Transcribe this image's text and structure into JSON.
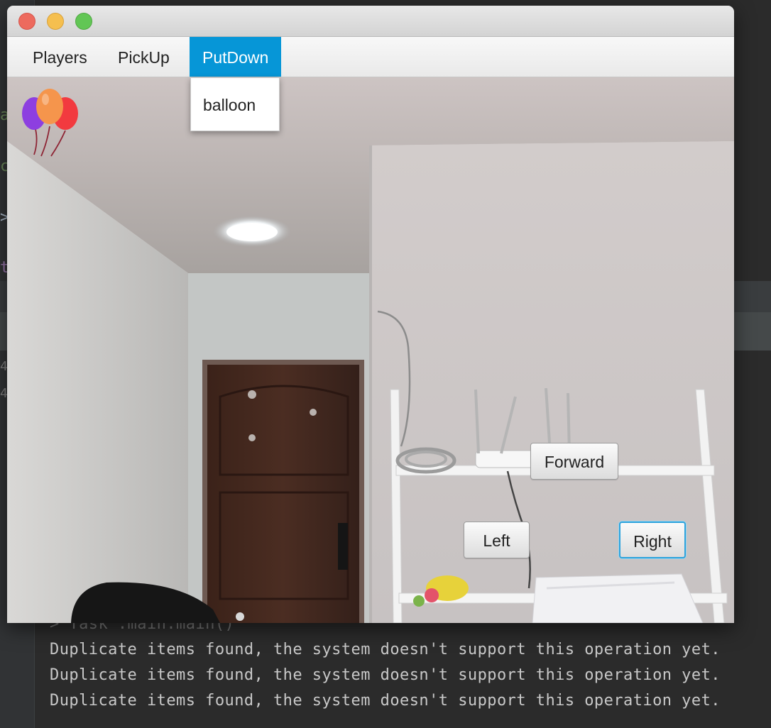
{
  "ide": {
    "fragments": [
      "a",
      "c",
      ">",
      "t",
      "4",
      "4"
    ],
    "console_lines": [
      "> Task :main.main()",
      "Duplicate items found, the system doesn't support this operation yet.",
      "Duplicate items found, the system doesn't support this operation yet.",
      "Duplicate items found, the system doesn't support this operation yet."
    ]
  },
  "window": {
    "traffic_lights": {
      "close_color": "#ed6a5e",
      "minimize_color": "#f5bf4f",
      "zoom_color": "#62c655"
    },
    "menu": {
      "items": [
        {
          "label": "Players",
          "active": false
        },
        {
          "label": "PickUp",
          "active": false
        },
        {
          "label": "PutDown",
          "active": true
        }
      ],
      "active_color": "#0696d7",
      "dropdown": {
        "items": [
          "balloon"
        ]
      }
    },
    "scene": {
      "held_item_icon": "balloon-icon",
      "buttons": {
        "forward": "Forward",
        "left": "Left",
        "right": "Right"
      },
      "focused_button_color": "#2ea3dc"
    }
  }
}
